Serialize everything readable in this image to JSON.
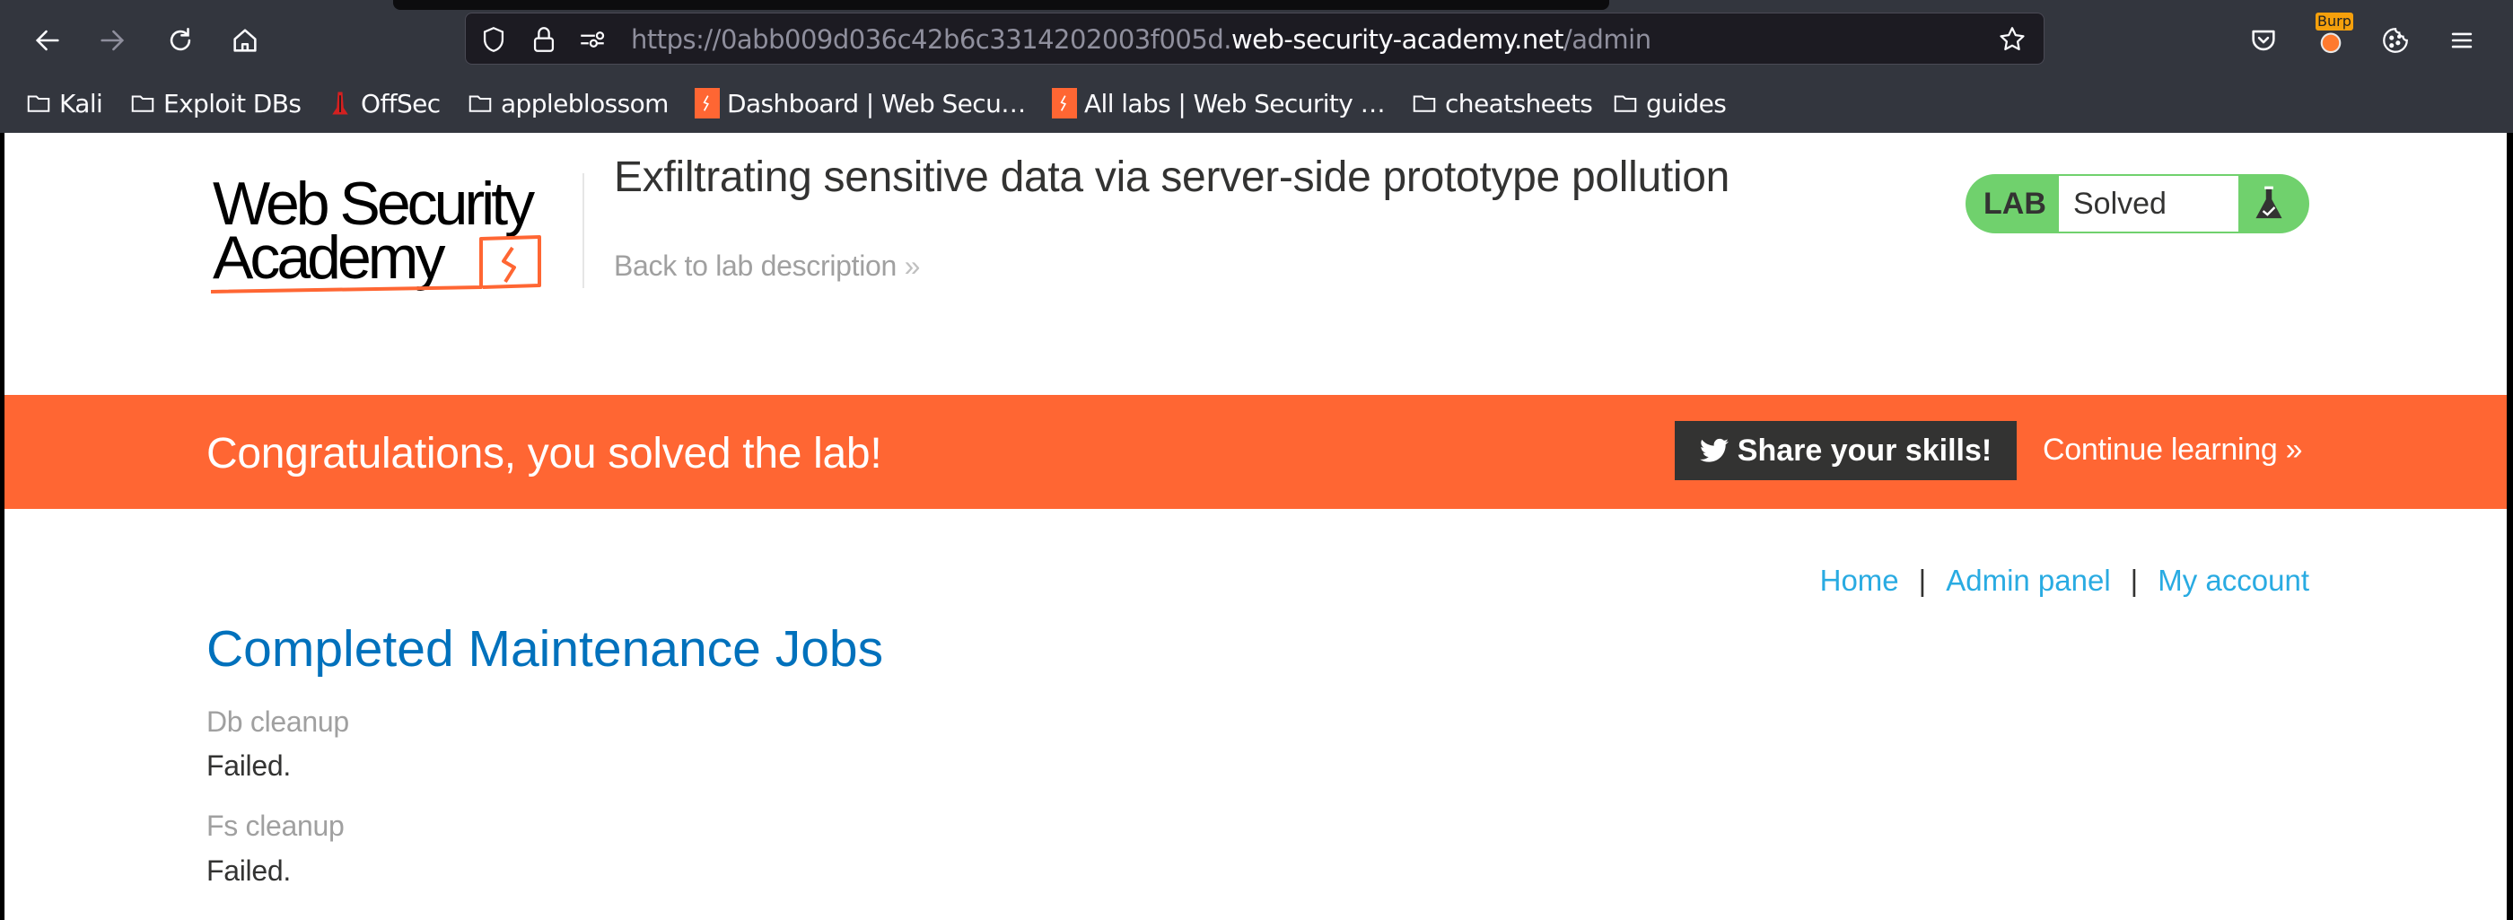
{
  "browser": {
    "url_prefix": "https://0abb009d036c42b6c3314202003f005d.",
    "url_host": "web-security-academy.net",
    "url_path": "/admin",
    "burp_badge": "Burp",
    "bookmarks": [
      {
        "label": "Kali",
        "icon": "folder-icon"
      },
      {
        "label": "Exploit DBs",
        "icon": "folder-icon"
      },
      {
        "label": "OffSec",
        "icon": "offsec-icon"
      },
      {
        "label": "appleblossom",
        "icon": "folder-icon"
      },
      {
        "label": "Dashboard | Web Secu…",
        "icon": "portswigger-icon"
      },
      {
        "label": "All labs | Web Security …",
        "icon": "portswigger-icon"
      },
      {
        "label": "cheatsheets",
        "icon": "folder-icon"
      },
      {
        "label": "guides",
        "icon": "folder-icon"
      }
    ]
  },
  "header": {
    "logo_line1": "Web Security",
    "logo_line2": "Academy",
    "lab_title": "Exfiltrating sensitive data via server-side prototype pollution",
    "back_link": "Back to lab description",
    "back_chevron": "»",
    "lab_badge_label": "LAB",
    "lab_status": "Solved"
  },
  "banner": {
    "message": "Congratulations, you solved the lab!",
    "share_label": "Share your skills!",
    "continue_label": "Continue learning",
    "continue_chevron": "»"
  },
  "nav": {
    "links": [
      "Home",
      "Admin panel",
      "My account"
    ],
    "separator": "|"
  },
  "main": {
    "title": "Completed Maintenance Jobs",
    "jobs": [
      {
        "name": "Db cleanup",
        "status": "Failed."
      },
      {
        "name": "Fs cleanup",
        "status": "Failed."
      }
    ]
  },
  "colors": {
    "brand_orange": "#ff6633",
    "solved_green": "#70d16d",
    "link_blue": "#29abe2",
    "heading_blue": "#0071bc"
  }
}
